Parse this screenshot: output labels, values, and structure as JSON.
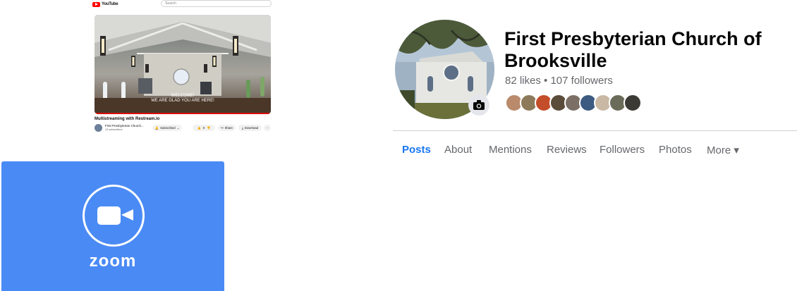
{
  "youtube": {
    "brand": "YouTube",
    "search_placeholder": "Search",
    "video_caption_line1": "WELCOME!",
    "video_caption_line2": "WE ARE GLAD YOU ARE HERE!",
    "video_title": "Multistreaming with Restream.io",
    "channel_name": "First Presbyterian Church...",
    "channel_subs": "13 subscribers",
    "subscribed_label": "Subscribed",
    "like_count": "0",
    "share_label": "Share",
    "download_label": "Download",
    "more_label": "···"
  },
  "zoom": {
    "wordmark": "zoom",
    "brand_color": "#4a8af4"
  },
  "facebook": {
    "page_name": "First Presbyterian Church of Brooksville",
    "likes": "82 likes",
    "separator": "•",
    "followers": "107 followers",
    "tabs": [
      {
        "label": "Posts",
        "active": true
      },
      {
        "label": "About"
      },
      {
        "label": "Mentions"
      },
      {
        "label": "Reviews"
      },
      {
        "label": "Followers"
      },
      {
        "label": "Photos"
      },
      {
        "label": "More ▾"
      }
    ],
    "accent_color": "#1877f2",
    "follower_avatar_colors": [
      "#b98a6c",
      "#8c7a5a",
      "#c44d2a",
      "#5b4b3a",
      "#7c6f66",
      "#3d5a80",
      "#c9b8a4",
      "#6b6b5a",
      "#3b3a34"
    ]
  }
}
